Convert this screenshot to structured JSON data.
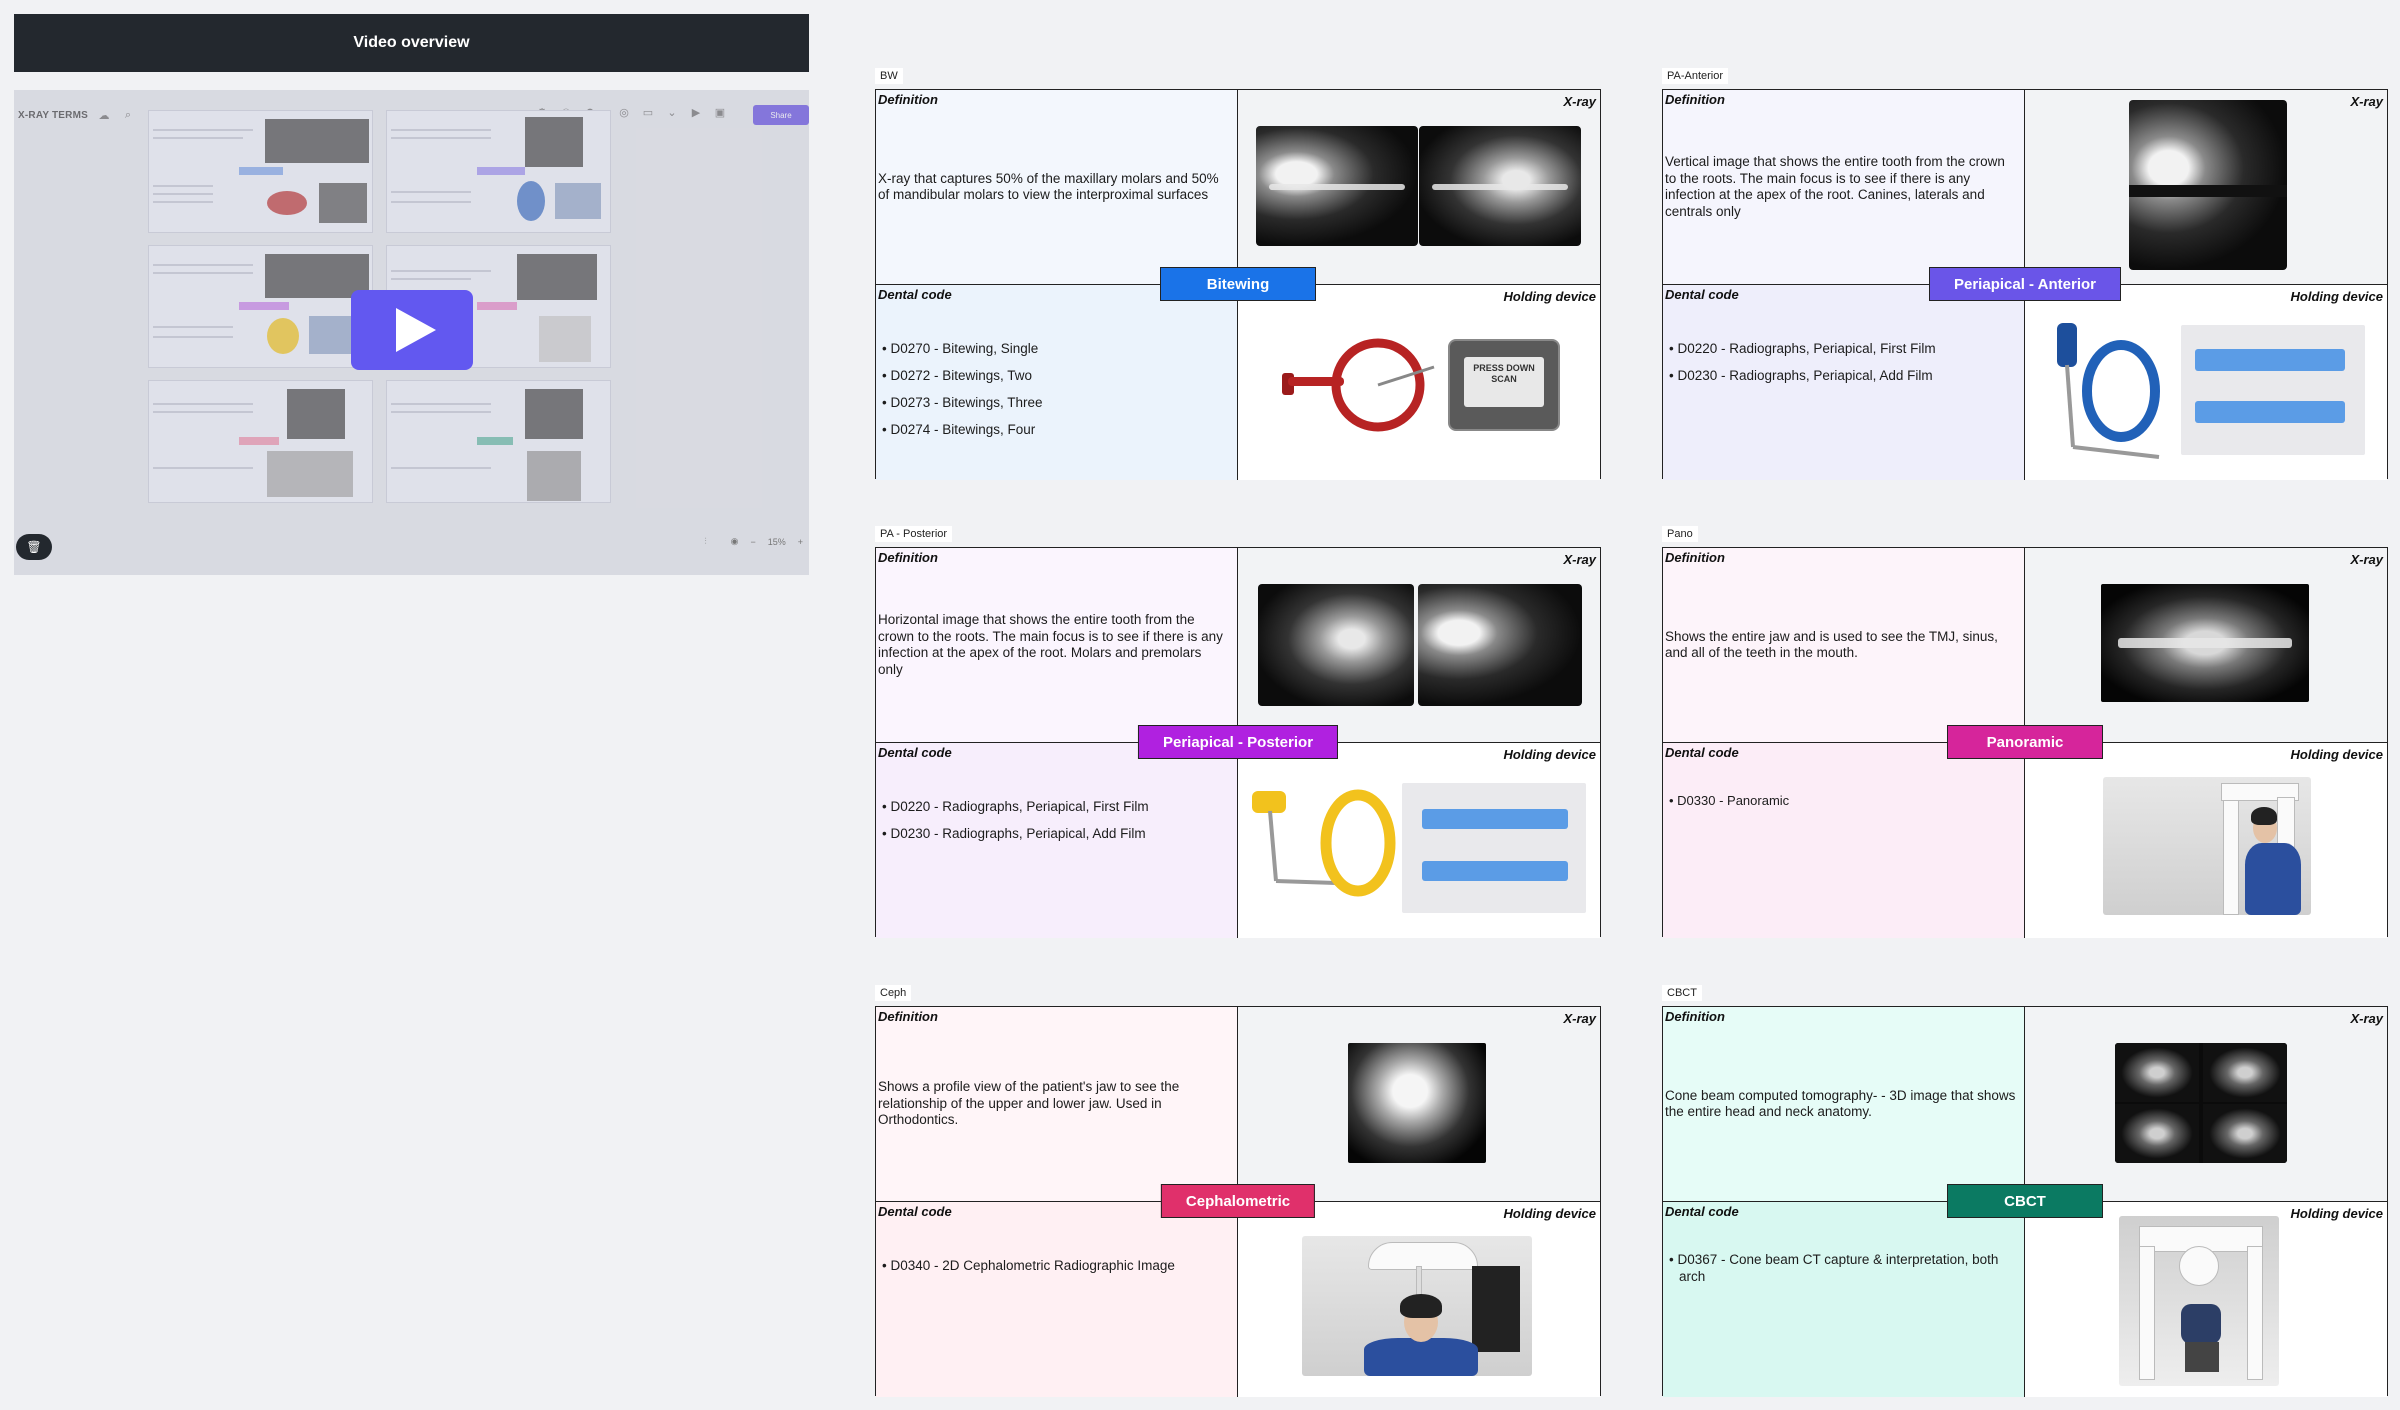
{
  "video": {
    "header": "Video overview",
    "board_title": "X-RAY TERMS",
    "share_label": "Share",
    "zoom": "15%",
    "zoom_out": "−",
    "zoom_in": "+"
  },
  "cards": [
    {
      "id": "bw",
      "label": "BW",
      "banner": "Bitewing",
      "banner_color": "#1a73e8",
      "def_bg": "#f3f7fd",
      "code_bg": "#ebf3fc",
      "def_title": "Definition",
      "xray_title": "X-ray",
      "code_title": "Dental code",
      "device_title": "Holding device",
      "definition": "X-ray that captures 50% of the maxillary molars and 50% of mandibular molars to view the interproximal surfaces",
      "codes": [
        "D0270 - Bitewing, Single",
        "D0272 - Bitewings, Two",
        "D0273 - Bitewings, Three",
        "D0274 - Bitewings, Four"
      ],
      "device_text": "PRESS DOWN SCAN"
    },
    {
      "id": "pa-anterior",
      "label": "PA-Anterior",
      "banner": "Periapical - Anterior",
      "banner_color": "#6a55e8",
      "def_bg": "#f5f5fd",
      "code_bg": "#eeeefb",
      "def_title": "Definition",
      "xray_title": "X-ray",
      "code_title": "Dental code",
      "device_title": "Holding device",
      "definition": "Vertical image that shows the entire tooth from the crown to the roots. The main focus is to see if there is any infection at the apex of the root. Canines, laterals and centrals only",
      "codes": [
        "D0220 - Radiographs, Periapical, First Film",
        "D0230 - Radiographs, Periapical, Add Film"
      ]
    },
    {
      "id": "pa-posterior",
      "label": "PA - Posterior",
      "banner": "Periapical - Posterior",
      "banner_color": "#b021e0",
      "def_bg": "#fbf5fe",
      "code_bg": "#f7eefc",
      "def_title": "Definition",
      "xray_title": "X-ray",
      "code_title": "Dental code",
      "device_title": "Holding device",
      "definition": "Horizontal image that shows the entire tooth from the crown to the roots. The main focus is to see if there is any infection at the apex of the root.  Molars and premolars only",
      "codes": [
        "D0220 - Radiographs, Periapical, First Film",
        "D0230 - Radiographs, Periapical, Add Film"
      ]
    },
    {
      "id": "pano",
      "label": "Pano",
      "banner": "Panoramic",
      "banner_color": "#d6259b",
      "def_bg": "#fdf4fa",
      "code_bg": "#fcedf7",
      "def_title": "Definition",
      "xray_title": "X-ray",
      "code_title": "Dental code",
      "device_title": "Holding device",
      "definition": "Shows the entire jaw and is used to see the TMJ, sinus, and all of the teeth in the mouth.",
      "codes": [
        "D0330 - Panoramic"
      ]
    },
    {
      "id": "ceph",
      "label": "Ceph",
      "banner": "Cephalometric",
      "banner_color": "#e0306b",
      "def_bg": "#fff5f8",
      "code_bg": "#fff0f3",
      "def_title": "Definition",
      "xray_title": "X-ray",
      "code_title": "Dental code",
      "device_title": "Holding device",
      "definition": "Shows a profile view of the patient's jaw to see the relationship of the upper and lower jaw. Used in Orthodontics.",
      "codes": [
        "D0340 - 2D Cephalometric Radiographic Image"
      ]
    },
    {
      "id": "cbct",
      "label": "CBCT",
      "banner": "CBCT",
      "banner_color": "#0b7a62",
      "def_bg": "#e6fcf7",
      "code_bg": "#d8f8f1",
      "def_title": "Definition",
      "xray_title": "X-ray",
      "code_title": "Dental code",
      "device_title": "Holding device",
      "definition": "Cone beam computed tomography- - 3D image that shows the entire head and neck anatomy.",
      "codes": [
        "D0367 - Cone beam CT capture & interpretation, both arch"
      ]
    }
  ]
}
